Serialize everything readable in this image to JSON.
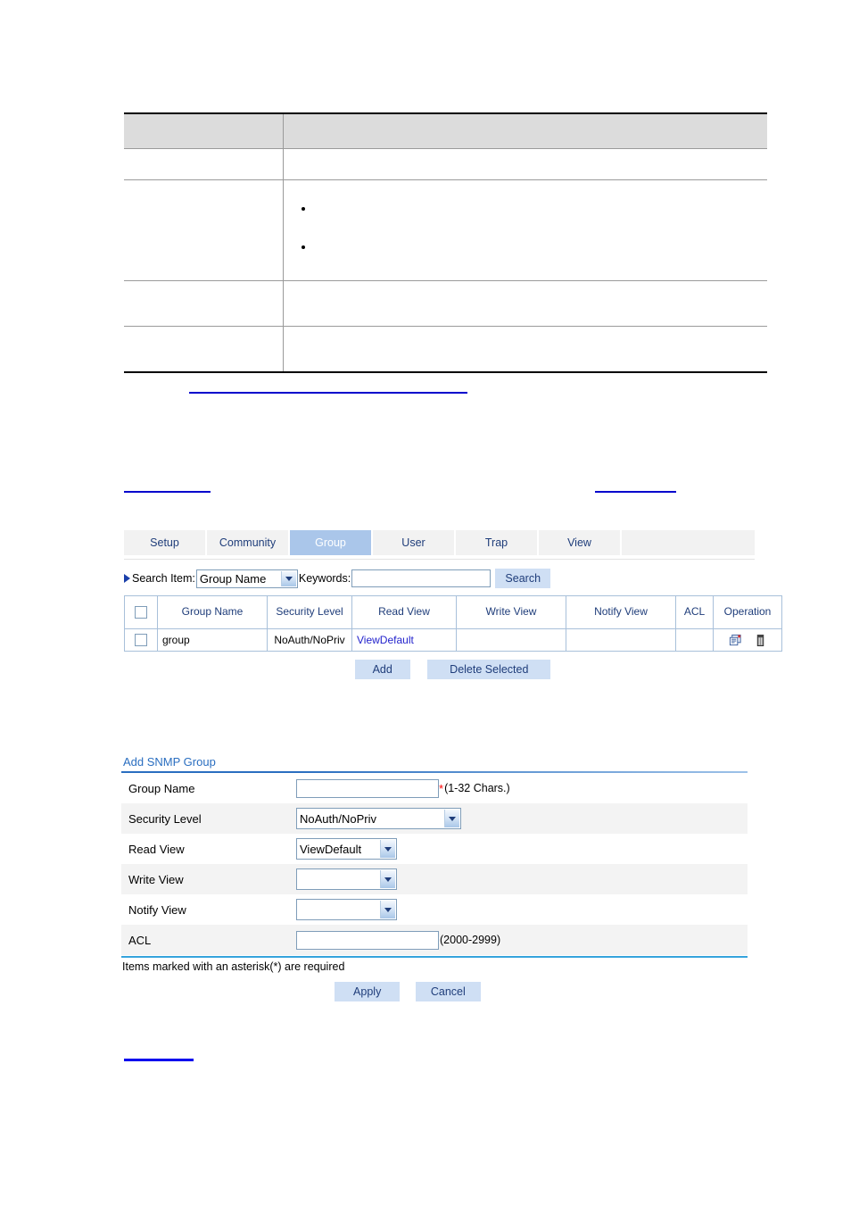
{
  "doc_table": {
    "header": [
      "",
      ""
    ],
    "rows": [
      {
        "label": "",
        "content": "",
        "bullets": []
      },
      {
        "label": "",
        "content": "",
        "bullets": [
          "",
          ""
        ]
      },
      {
        "label": "",
        "content": "",
        "bullets": []
      },
      {
        "label": "",
        "content": "",
        "bullets": []
      }
    ]
  },
  "webui": {
    "tabs": [
      {
        "label": "Setup",
        "active": false
      },
      {
        "label": "Community",
        "active": false
      },
      {
        "label": "Group",
        "active": true
      },
      {
        "label": "User",
        "active": false
      },
      {
        "label": "Trap",
        "active": false
      },
      {
        "label": "View",
        "active": false
      }
    ],
    "search": {
      "item_label": "Search Item:",
      "item_value": "Group Name",
      "keywords_label": "Keywords:",
      "keywords_value": "",
      "keywords_placeholder": "",
      "button_label": "Search",
      "marker_icon": "triangle-right-icon",
      "dropdown_icon": "chevron-down-icon"
    },
    "grid": {
      "columns": [
        "",
        "Group Name",
        "Security Level",
        "Read View",
        "Write View",
        "Notify View",
        "ACL",
        "Operation"
      ],
      "rows": [
        {
          "selected": false,
          "group_name": "group",
          "security_level": "NoAuth/NoPriv",
          "read_view": "ViewDefault",
          "write_view": "",
          "notify_view": "",
          "acl": "",
          "operations": [
            "edit-icon",
            "delete-icon"
          ]
        }
      ],
      "buttons": [
        {
          "label": "Add"
        },
        {
          "label": "Delete Selected"
        }
      ]
    }
  },
  "form": {
    "title": "Add SNMP Group",
    "fields": [
      {
        "label": "Group Name",
        "type": "text",
        "value": "",
        "required": true,
        "hint": "(1-32 Chars.)",
        "required_mark": "*"
      },
      {
        "label": "Security Level",
        "type": "select",
        "value": "NoAuth/NoPriv",
        "required": false,
        "hint": ""
      },
      {
        "label": "Read View",
        "type": "select",
        "value": "ViewDefault",
        "required": false,
        "hint": ""
      },
      {
        "label": "Write View",
        "type": "select",
        "value": "",
        "required": false,
        "hint": ""
      },
      {
        "label": "Notify View",
        "type": "select",
        "value": "",
        "required": false,
        "hint": ""
      },
      {
        "label": "ACL",
        "type": "text",
        "value": "",
        "required": false,
        "hint": "(2000-2999)",
        "required_mark": ""
      }
    ],
    "note": "Items marked with an asterisk(*) are required",
    "buttons": [
      {
        "label": "Apply"
      },
      {
        "label": "Cancel"
      }
    ]
  },
  "links": [
    {
      "id": "link-mid-1",
      "text": ""
    },
    {
      "id": "link-row-left",
      "text": ""
    },
    {
      "id": "link-row-right",
      "text": ""
    },
    {
      "id": "link-bottom",
      "text": ""
    }
  ],
  "colors": {
    "tab_active_bg": "#aac6ea",
    "tab_text": "#1f3d7a",
    "button_bg": "#cfdff4",
    "link_blue": "#0000cc",
    "form_title": "#2a6ec0",
    "form_rule": "#35a3dc",
    "required_red": "#ff0000",
    "grid_border": "#a8c0da",
    "doc_header_bg": "#dcdcdc"
  }
}
